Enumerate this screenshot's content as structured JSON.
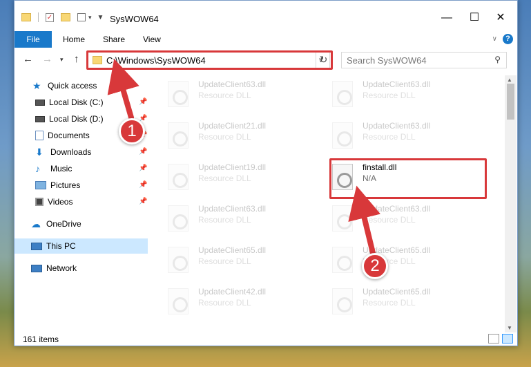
{
  "window": {
    "title": "SysWOW64",
    "controls": {
      "minimize": "—",
      "maximize": "☐",
      "close": "✕"
    }
  },
  "ribbon": {
    "tabs": [
      "File",
      "Home",
      "Share",
      "View"
    ]
  },
  "nav": {
    "address_path": "C:\\Windows\\SysWOW64",
    "search_placeholder": "Search SysWOW64"
  },
  "sidebar": {
    "quick_access": "Quick access",
    "items": [
      {
        "label": "Local Disk (C:)",
        "icon": "drive-icon",
        "pinned": true
      },
      {
        "label": "Local Disk (D:)",
        "icon": "drive-icon",
        "pinned": true
      },
      {
        "label": "Documents",
        "icon": "documents-icon",
        "pinned": true
      },
      {
        "label": "Downloads",
        "icon": "downloads-icon",
        "pinned": true
      },
      {
        "label": "Music",
        "icon": "music-icon",
        "pinned": true
      },
      {
        "label": "Pictures",
        "icon": "pictures-icon",
        "pinned": true
      },
      {
        "label": "Videos",
        "icon": "videos-icon",
        "pinned": true
      }
    ],
    "onedrive": "OneDrive",
    "this_pc": "This PC",
    "network": "Network"
  },
  "files": {
    "col1": [
      {
        "name": "UpdateClient63.dll",
        "type": "Resource DLL"
      },
      {
        "name": "UpdateClient21.dll",
        "type": "Resource DLL"
      },
      {
        "name": "UpdateClient19.dll",
        "type": "Resource DLL"
      },
      {
        "name": "UpdateClient63.dll",
        "type": "Resource DLL"
      },
      {
        "name": "UpdateClient65.dll",
        "type": "Resource DLL"
      },
      {
        "name": "UpdateClient42.dll",
        "type": "Resource DLL"
      }
    ],
    "col2": [
      {
        "name": "UpdateClient63.dll",
        "type": "Resource DLL"
      },
      {
        "name": "UpdateClient63.dll",
        "type": "Resource DLL"
      },
      {
        "name": "finstall.dll",
        "type": "N/A"
      },
      {
        "name": "UpdateClient63.dll",
        "type": "Resource DLL"
      },
      {
        "name": "UpdateClient65.dll",
        "type": "Resource DLL"
      },
      {
        "name": "UpdateClient65.dll",
        "type": "Resource DLL"
      }
    ]
  },
  "status": {
    "item_count": "161 items"
  },
  "annotations": {
    "step1": "1",
    "step2": "2"
  },
  "colors": {
    "accent": "#1979ca",
    "highlight": "#d8383a",
    "selected": "#cce8ff"
  }
}
